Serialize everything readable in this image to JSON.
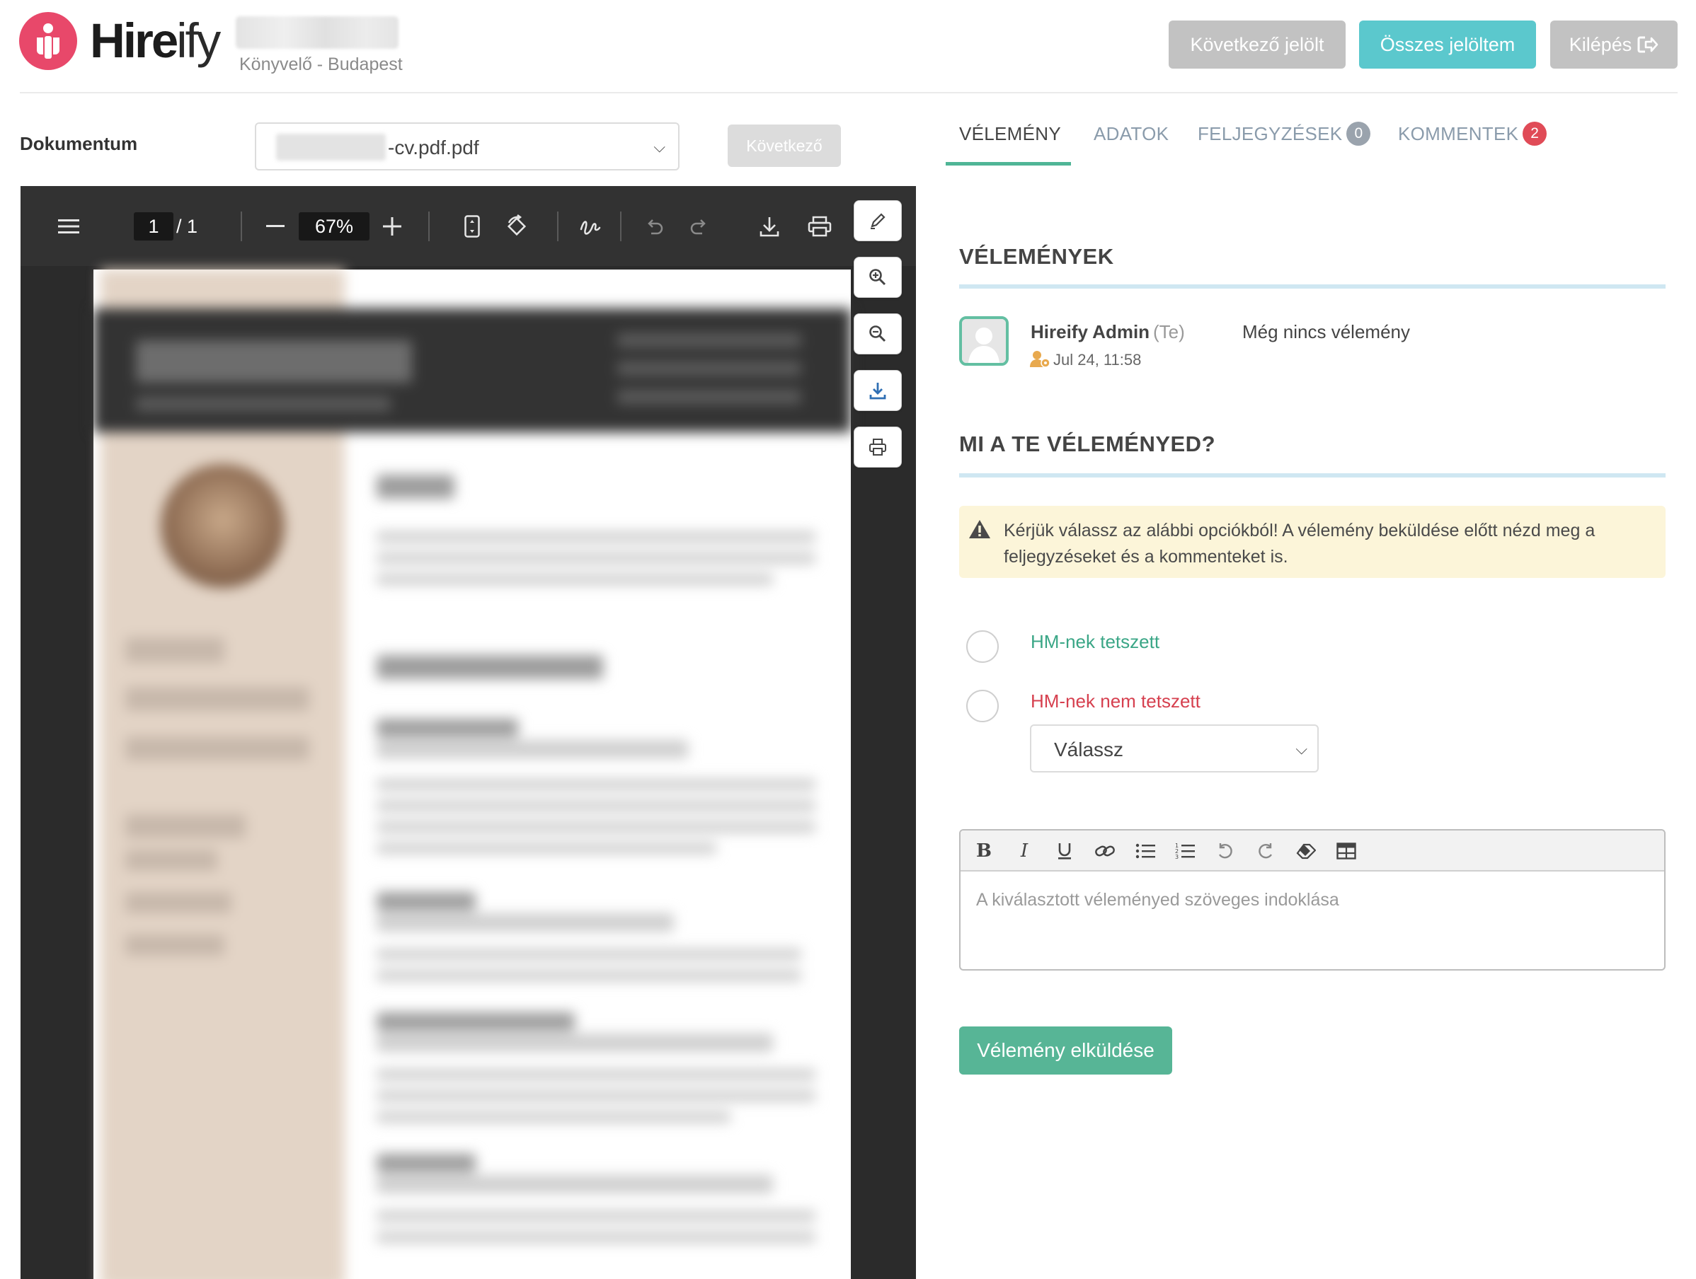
{
  "brand": {
    "name_bold": "Hire",
    "name_light": "ify"
  },
  "candidate": {
    "job_title": "Könyvelő - Budapest"
  },
  "header": {
    "next_candidate_label": "Következő jelölt",
    "all_rated_label": "Összes jelöltem",
    "logout_label": "Kilépés"
  },
  "document": {
    "label": "Dokumentum",
    "file_suffix": "-cv.pdf.pdf",
    "next_label": "Következő"
  },
  "pdf_toolbar": {
    "current_page": "1",
    "total_pages": "/ 1",
    "zoom": "67%"
  },
  "tabs": {
    "opinion": "VÉLEMÉNY",
    "data": "ADATOK",
    "notes": "FELJEGYZÉSEK",
    "notes_count": "0",
    "comments": "KOMMENTEK",
    "comments_count": "2"
  },
  "opinions": {
    "title": "VÉLEMÉNYEK",
    "reviewer_name": "Hireify Admin",
    "reviewer_you": "(Te)",
    "reviewer_date": "Jul 24, 11:58",
    "no_opinion": "Még nincs vélemény"
  },
  "your_opinion": {
    "title": "MI A TE VÉLEMÉNYED?",
    "warning": "Kérjük válassz az alábbi opciókból! A vélemény beküldése előtt nézd meg a feljegyzéseket és a kommenteket is.",
    "option_liked": "HM-nek tetszett",
    "option_disliked": "HM-nek nem tetszett",
    "reason_select": "Válassz",
    "editor_placeholder": "A kiválasztott véleményed szöveges indoklása",
    "submit_label": "Vélemény elküldése"
  },
  "colors": {
    "brand_red": "#e8486a",
    "accent_teal": "#5bc8cd",
    "success_green": "#57b596",
    "danger_red": "#d6404f",
    "warning_bg": "#fcf5d9"
  }
}
